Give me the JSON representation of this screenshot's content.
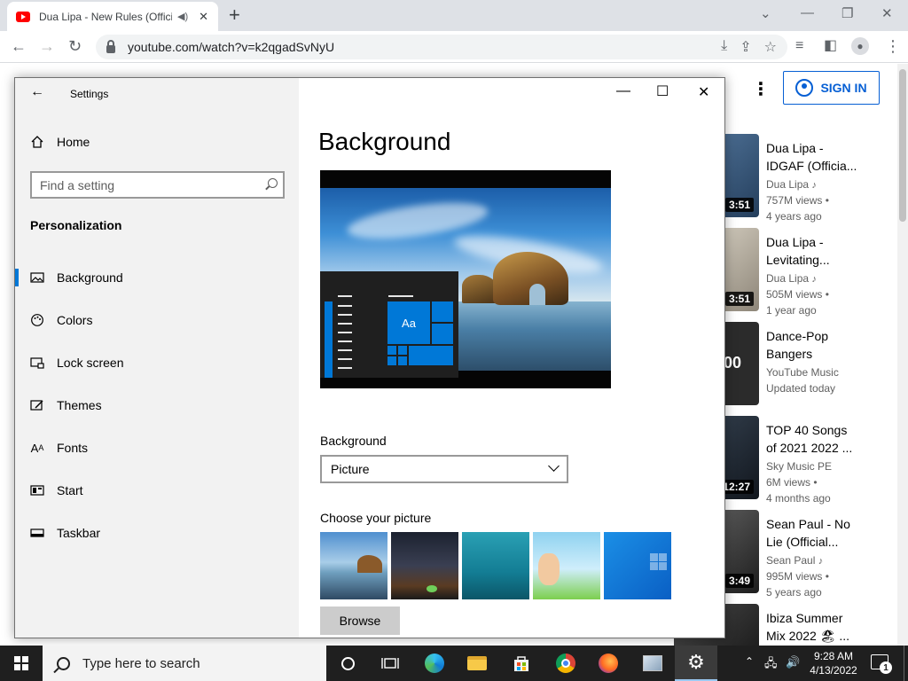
{
  "browser": {
    "tab_title": "Dua Lipa - New Rules (Offici",
    "tab_close": "✕",
    "new_tab": "+",
    "url": "youtube.com/watch?v=k2qgadSvNyU"
  },
  "youtube": {
    "sign_in_label": "SIGN IN",
    "recommendations": [
      {
        "title": "Dua Lipa - IDGAF (Officia...",
        "channel": "Dua Lipa",
        "meta1": "757M views •",
        "meta2": "4 years ago",
        "duration": "3:51"
      },
      {
        "title": "Dua Lipa - Levitating...",
        "channel": "Dua Lipa",
        "meta1": "505M views •",
        "meta2": "1 year ago",
        "duration": "3:51"
      },
      {
        "title": "Dance-Pop Bangers",
        "channel": "YouTube Music",
        "meta1": "Updated today",
        "meta2": "",
        "duration": "00"
      },
      {
        "title": "TOP 40 Songs of 2021 2022 ...",
        "channel": "Sky Music PE",
        "meta1": "6M views •",
        "meta2": "4 months ago",
        "duration": "12:27"
      },
      {
        "title": "Sean Paul - No Lie (Official...",
        "channel": "Sean Paul",
        "meta1": "995M views •",
        "meta2": "5 years ago",
        "duration": "3:49"
      },
      {
        "title": "Ibiza Summer Mix 2022 🏖 ...",
        "channel": "",
        "meta1": "",
        "meta2": "",
        "duration": ""
      }
    ]
  },
  "settings": {
    "window_title": "Settings",
    "home_label": "Home",
    "search_placeholder": "Find a setting",
    "section_title": "Personalization",
    "nav_items": [
      {
        "label": "Background",
        "icon": "picture-icon",
        "active": true
      },
      {
        "label": "Colors",
        "icon": "palette-icon",
        "active": false
      },
      {
        "label": "Lock screen",
        "icon": "lock-screen-icon",
        "active": false
      },
      {
        "label": "Themes",
        "icon": "themes-icon",
        "active": false
      },
      {
        "label": "Fonts",
        "icon": "fonts-icon",
        "active": false
      },
      {
        "label": "Start",
        "icon": "start-icon",
        "active": false
      },
      {
        "label": "Taskbar",
        "icon": "taskbar-icon",
        "active": false
      }
    ],
    "page_heading": "Background",
    "preview_tile_text": "Aa",
    "background_label": "Background",
    "background_value": "Picture",
    "choose_label": "Choose your picture",
    "browse_label": "Browse",
    "accent_color": "#0078d7"
  },
  "taskbar": {
    "search_placeholder": "Type here to search",
    "time": "9:28 AM",
    "date": "4/13/2022",
    "notification_count": "1"
  }
}
